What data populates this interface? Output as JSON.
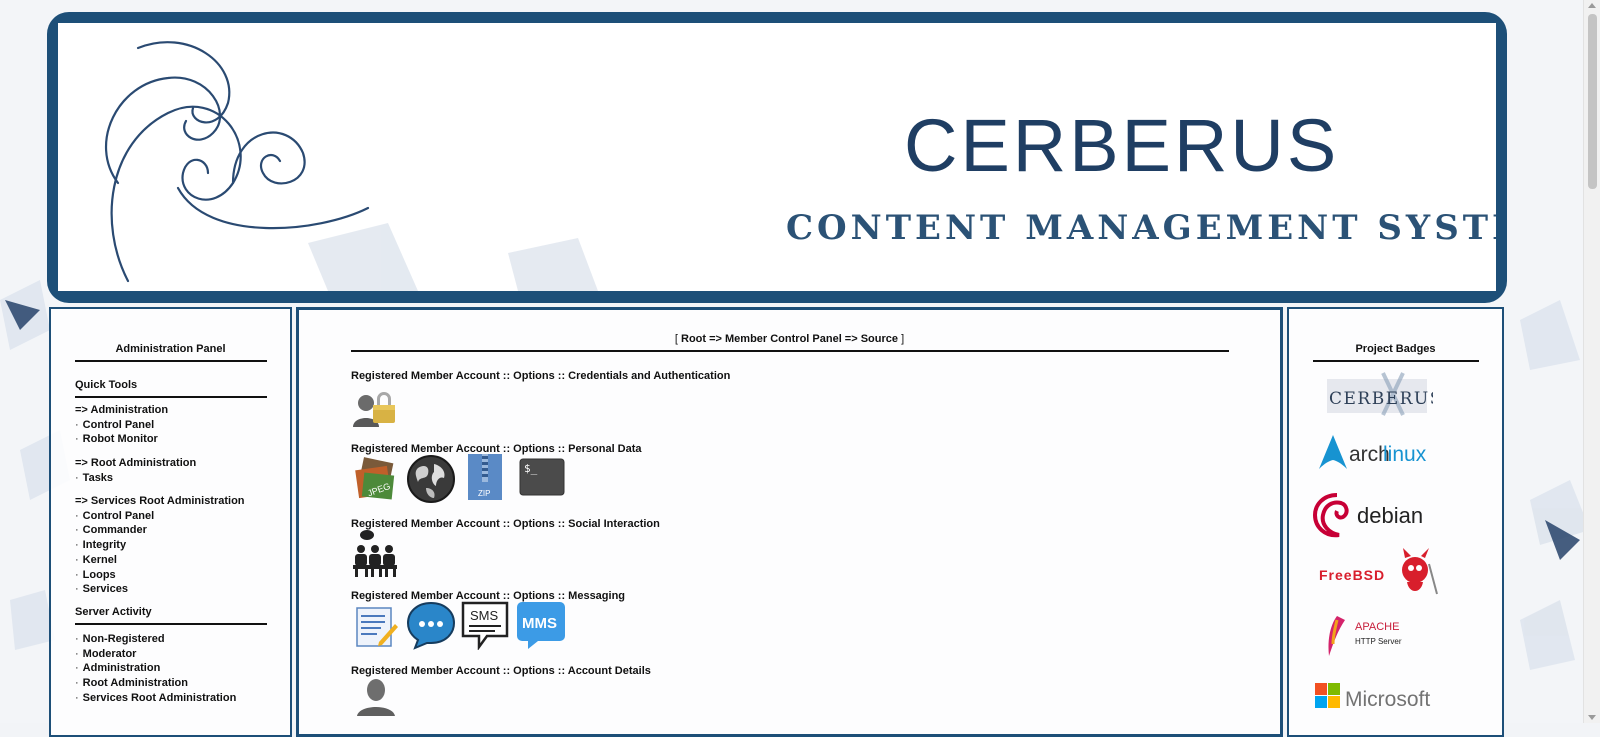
{
  "banner": {
    "title": "CERBERUS",
    "subtitle": "CONTENT MANAGEMENT SYSTEM"
  },
  "left_panel": {
    "heading": "Administration Panel",
    "quick_tools_heading": "Quick Tools",
    "groups": [
      {
        "title": "=> Administration",
        "items": [
          "Control Panel",
          "Robot Monitor"
        ]
      },
      {
        "title": "=> Root Administration",
        "items": [
          "Tasks"
        ]
      },
      {
        "title": "=> Services Root Administration",
        "items": [
          "Control Panel",
          "Commander",
          "Integrity",
          "Kernel",
          "Loops",
          "Services"
        ]
      }
    ],
    "server_activity_heading": "Server Activity",
    "activity_items": [
      "Non-Registered",
      "Moderator",
      "Administration",
      "Root Administration",
      "Services Root Administration"
    ],
    "bullet": "·"
  },
  "breadcrumb": {
    "open": "[",
    "path": "Root => Member Control Panel => Source",
    "close": "]"
  },
  "sections": [
    {
      "heading": "Registered Member Account :: Options :: Credentials and Authentication",
      "icons": [
        "user-lock-icon"
      ]
    },
    {
      "heading": "Registered Member Account :: Options :: Personal Data",
      "icons": [
        "jpeg-images-icon",
        "globe-icon",
        "zip-archive-icon",
        "terminal-icon"
      ]
    },
    {
      "heading": "Registered Member Account :: Options :: Social Interaction",
      "icons": [
        "group-chat-icon"
      ]
    },
    {
      "heading": "Registered Member Account :: Options :: Messaging",
      "icons": [
        "notepad-icon",
        "chat-bubble-icon",
        "sms-icon",
        "mms-icon"
      ]
    },
    {
      "heading": "Registered Member Account :: Options :: Account Details",
      "icons": [
        "user-silhouette-icon"
      ]
    }
  ],
  "icon_labels": {
    "jpeg": "JPEG",
    "zip": "ZIP",
    "terminal": "$_",
    "sms": "SMS",
    "mms": "MMS"
  },
  "right_panel": {
    "heading": "Project Badges",
    "badges": [
      {
        "name": "CERBERUS"
      },
      {
        "name": "arch",
        "suffix": "linux"
      },
      {
        "name": "debian"
      },
      {
        "name": "FreeBSD"
      },
      {
        "name": "APACHE",
        "sub": "HTTP Server"
      },
      {
        "name": "Microsoft"
      }
    ]
  },
  "colors": {
    "frame_blue": "#1d4f78",
    "title_blue": "#1f3e63",
    "arch_blue": "#1793d1",
    "debian_red": "#c70036",
    "freebsd_red": "#d81e2c"
  }
}
